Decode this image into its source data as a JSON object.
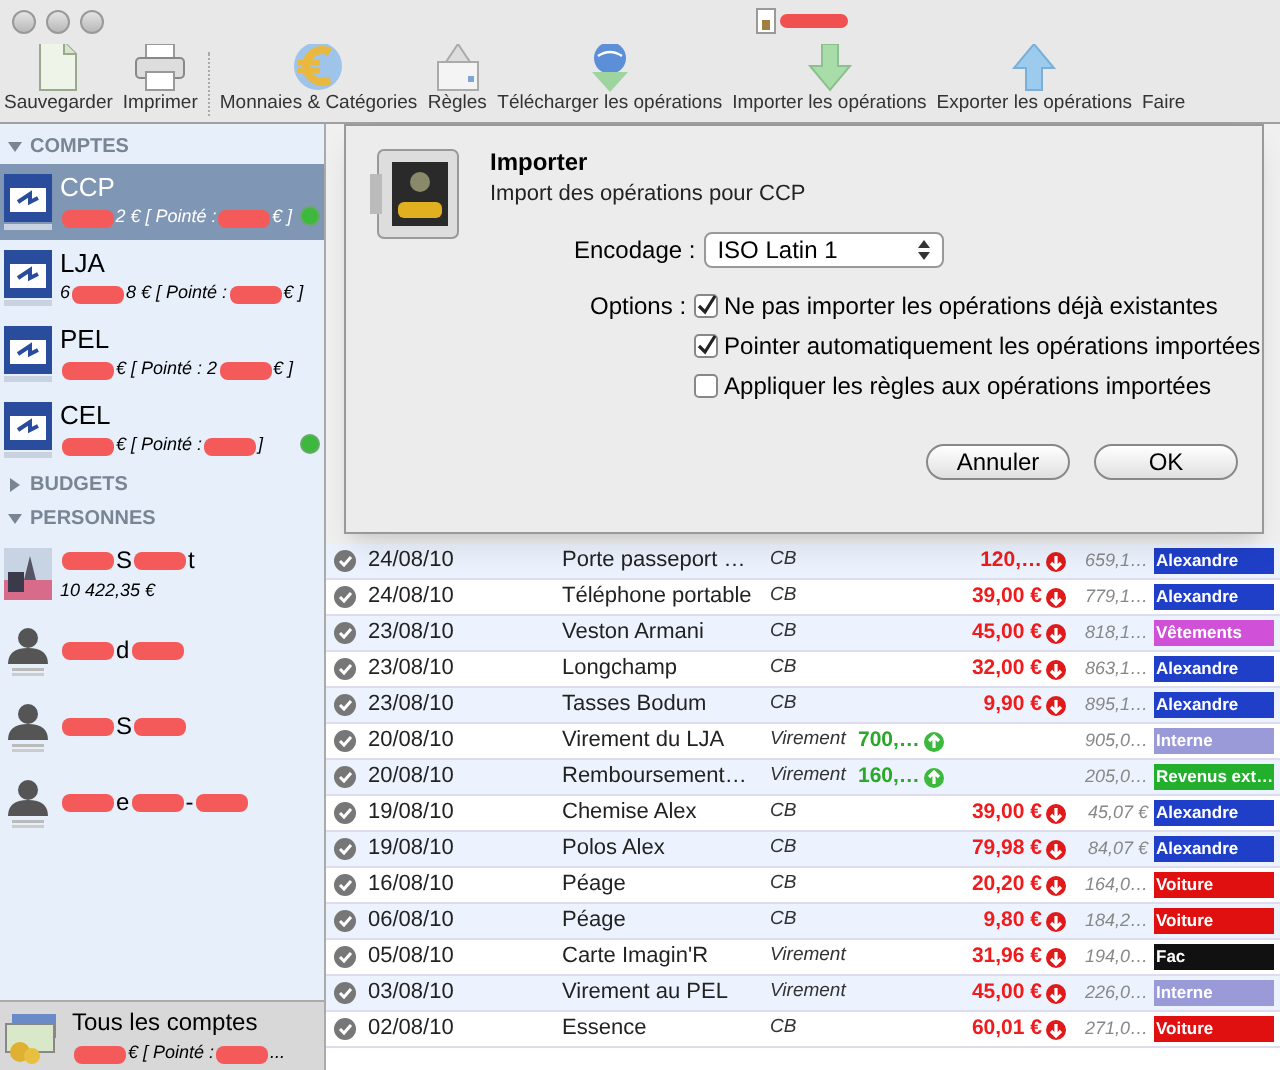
{
  "window": {
    "title_redacted": true
  },
  "toolbar": [
    {
      "label": "Sauvegarder",
      "kind": "document"
    },
    {
      "label": "Imprimer",
      "kind": "printer"
    },
    {
      "label": "Monnaies & Catégories",
      "kind": "euro"
    },
    {
      "label": "Règles",
      "kind": "rules"
    },
    {
      "label": "Télécharger les opérations",
      "kind": "globe"
    },
    {
      "label": "Importer les opérations",
      "kind": "down"
    },
    {
      "label": "Exporter les opérations",
      "kind": "up"
    },
    {
      "label": "Faire",
      "kind": "none"
    }
  ],
  "sidebar": {
    "sections": [
      {
        "title": "COMPTES",
        "expanded": true,
        "kind": "accounts",
        "items": [
          {
            "name": "CCP",
            "selected": true,
            "status_dot": true,
            "balance": [
              {
                "kind": "redacted"
              },
              {
                "kind": "text",
                "text": "2 € [ Pointé :"
              },
              {
                "kind": "redacted"
              },
              {
                "kind": "text",
                "text": "€ ]"
              }
            ]
          },
          {
            "name": "LJA",
            "selected": false,
            "status_dot": false,
            "balance": [
              {
                "kind": "text",
                "text": "6"
              },
              {
                "kind": "redacted"
              },
              {
                "kind": "text",
                "text": "8 € [ Pointé :"
              },
              {
                "kind": "redacted"
              },
              {
                "kind": "text",
                "text": "€ ]"
              }
            ]
          },
          {
            "name": "PEL",
            "selected": false,
            "status_dot": false,
            "balance": [
              {
                "kind": "redacted"
              },
              {
                "kind": "text",
                "text": "€ [ Pointé : 2"
              },
              {
                "kind": "redacted"
              },
              {
                "kind": "text",
                "text": "€ ]"
              }
            ]
          },
          {
            "name": "CEL",
            "selected": false,
            "status_dot": true,
            "balance": [
              {
                "kind": "redacted"
              },
              {
                "kind": "text",
                "text": "€ [ Pointé :"
              },
              {
                "kind": "redacted"
              },
              {
                "kind": "text",
                "text": "]"
              }
            ]
          }
        ]
      },
      {
        "title": "BUDGETS",
        "expanded": false
      },
      {
        "title": "PERSONNES",
        "expanded": true,
        "kind": "people",
        "items": [
          {
            "name": [
              {
                "kind": "redacted"
              },
              {
                "kind": "text",
                "text": "S"
              },
              {
                "kind": "redacted"
              },
              {
                "kind": "text",
                "text": "t"
              }
            ],
            "amount": "10 422,35 €"
          },
          {
            "kind": "silhouette",
            "name": [
              {
                "kind": "redacted"
              },
              {
                "kind": "text",
                "text": "d"
              },
              {
                "kind": "redacted"
              }
            ]
          },
          {
            "kind": "silhouette",
            "name": [
              {
                "kind": "redacted"
              },
              {
                "kind": "text",
                "text": "S"
              },
              {
                "kind": "redacted"
              }
            ]
          },
          {
            "kind": "silhouette",
            "name": [
              {
                "kind": "redacted"
              },
              {
                "kind": "text",
                "text": "e"
              },
              {
                "kind": "redacted"
              },
              {
                "kind": "text",
                "text": "-"
              },
              {
                "kind": "redacted"
              }
            ]
          }
        ]
      }
    ],
    "footer": {
      "title": "Tous les comptes",
      "balance": [
        {
          "kind": "redacted"
        },
        {
          "kind": "text",
          "text": "€ [ Pointé :"
        },
        {
          "kind": "redacted"
        },
        {
          "kind": "text",
          "text": "..."
        }
      ]
    }
  },
  "dialog": {
    "title": "Importer",
    "subtitle": "Import des opérations pour CCP",
    "encoding_label": "Encodage :",
    "encoding_value": "ISO Latin 1",
    "options_label": "Options :",
    "options": [
      {
        "label": "Ne pas importer les opérations déjà existantes",
        "checked": true
      },
      {
        "label": "Pointer automatiquement les opérations importées",
        "checked": true
      },
      {
        "label": "Appliquer les règles aux opérations importées",
        "checked": false
      }
    ],
    "buttons": [
      "Annuler",
      "OK"
    ]
  },
  "table": {
    "rows": [
      {
        "date": "24/08/10",
        "name": "Porte passeport …",
        "type": "CB",
        "debit": "120,…",
        "balance": "659,1…",
        "category": {
          "label": "Alexandre",
          "color": "#1f3fc8"
        }
      },
      {
        "date": "24/08/10",
        "name": "Téléphone portable",
        "type": "CB",
        "debit": "39,00 €",
        "balance": "779,1…",
        "category": {
          "label": "Alexandre",
          "color": "#1f3fc8"
        }
      },
      {
        "date": "23/08/10",
        "name": "Veston Armani",
        "type": "CB",
        "debit": "45,00 €",
        "balance": "818,1…",
        "category": {
          "label": "Vêtements",
          "color": "#d050d8"
        }
      },
      {
        "date": "23/08/10",
        "name": "Longchamp",
        "type": "CB",
        "debit": "32,00 €",
        "balance": "863,1…",
        "category": {
          "label": "Alexandre",
          "color": "#1f3fc8"
        }
      },
      {
        "date": "23/08/10",
        "name": "Tasses Bodum",
        "type": "CB",
        "debit": "9,90 €",
        "balance": "895,1…",
        "category": {
          "label": "Alexandre",
          "color": "#1f3fc8"
        }
      },
      {
        "date": "20/08/10",
        "name": "Virement du LJA",
        "type": "Virement",
        "credit": "700,…",
        "balance": "905,0…",
        "category": {
          "label": "Interne",
          "color": "#9a9ad8"
        }
      },
      {
        "date": "20/08/10",
        "name": "Remboursement…",
        "type": "Virement",
        "credit": "160,…",
        "balance": "205,0…",
        "category": {
          "label": "Revenus ext…",
          "color": "#22b02c"
        }
      },
      {
        "date": "19/08/10",
        "name": "Chemise Alex",
        "type": "CB",
        "debit": "39,00 €",
        "balance": "45,07 €",
        "category": {
          "label": "Alexandre",
          "color": "#1f3fc8"
        }
      },
      {
        "date": "19/08/10",
        "name": "Polos Alex",
        "type": "CB",
        "debit": "79,98 €",
        "balance": "84,07 €",
        "category": {
          "label": "Alexandre",
          "color": "#1f3fc8"
        }
      },
      {
        "date": "16/08/10",
        "name": "Péage",
        "type": "CB",
        "debit": "20,20 €",
        "balance": "164,0…",
        "category": {
          "label": "Voiture",
          "color": "#e01010"
        }
      },
      {
        "date": "06/08/10",
        "name": "Péage",
        "type": "CB",
        "debit": "9,80 €",
        "balance": "184,2…",
        "category": {
          "label": "Voiture",
          "color": "#e01010"
        }
      },
      {
        "date": "05/08/10",
        "name": "Carte Imagin'R",
        "type": "Virement",
        "debit": "31,96 €",
        "balance": "194,0…",
        "category": {
          "label": "Fac",
          "color": "#111111"
        }
      },
      {
        "date": "03/08/10",
        "name": "Virement au PEL",
        "type": "Virement",
        "debit": "45,00 €",
        "balance": "226,0…",
        "category": {
          "label": "Interne",
          "color": "#9a9ad8"
        }
      },
      {
        "date": "02/08/10",
        "name": "Essence",
        "type": "CB",
        "debit": "60,01 €",
        "balance": "271,0…",
        "category": {
          "label": "Voiture",
          "color": "#e01010"
        }
      }
    ]
  }
}
